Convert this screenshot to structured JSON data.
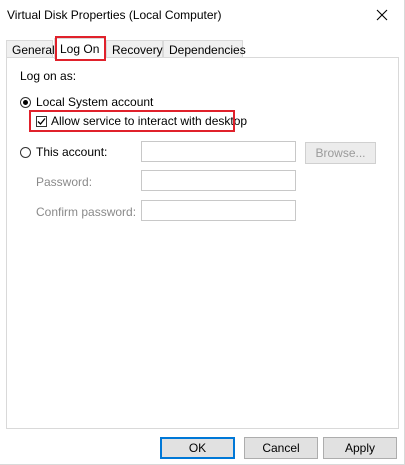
{
  "window": {
    "title": "Virtual Disk Properties (Local Computer)"
  },
  "tabs": [
    {
      "label": "General"
    },
    {
      "label": "Log On",
      "active": true
    },
    {
      "label": "Recovery"
    },
    {
      "label": "Dependencies"
    }
  ],
  "logon": {
    "section_label": "Log on as:",
    "local_system_label": "Local System account",
    "local_system_selected": true,
    "interact_desktop_label": "Allow service to interact with desktop",
    "interact_desktop_checked": true,
    "this_account_label": "This account:",
    "this_account_value": "",
    "browse_label": "Browse...",
    "password_label": "Password:",
    "password_value": "",
    "confirm_password_label": "Confirm password:",
    "confirm_password_value": ""
  },
  "buttons": {
    "ok": "OK",
    "cancel": "Cancel",
    "apply": "Apply"
  },
  "colors": {
    "highlight": "#e0212b",
    "accent": "#0078d7"
  }
}
